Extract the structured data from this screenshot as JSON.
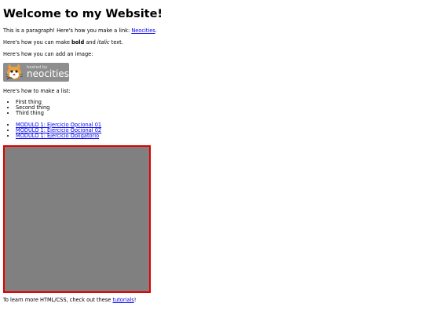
{
  "heading": "Welcome to my Website!",
  "intro": {
    "text": "This is a paragraph! Here's how you make a link: ",
    "link_label": "Neocities",
    "suffix": "."
  },
  "formatting": {
    "prefix": "Here's how you can make ",
    "bold": "bold",
    "middle": " and ",
    "italic": "italic",
    "suffix": " text."
  },
  "image_intro": "Here's how you can add an image:",
  "badge": {
    "hosted_by": "hosted by",
    "brand": "neocities"
  },
  "list_intro": "Here's how to make a list:",
  "list_items": [
    "First thing",
    "Second thing",
    "Third thing"
  ],
  "links": [
    "MODULO 1: Ejercicio Opcional 01",
    "MODULO 1: Ejercicio Opcional 02",
    "MODULO 1: Ejercicio Obligatorio"
  ],
  "footer": {
    "prefix": "To learn more HTML/CSS, check out these ",
    "link_label": "tutorials",
    "suffix": "!"
  },
  "colors": {
    "link": "#0000ee",
    "frame_border": "#dd0000",
    "frame_fill": "#808080",
    "badge_bg": "#8e8e8e"
  },
  "icons": {
    "badge_mascot": "neocities-cat-icon"
  }
}
